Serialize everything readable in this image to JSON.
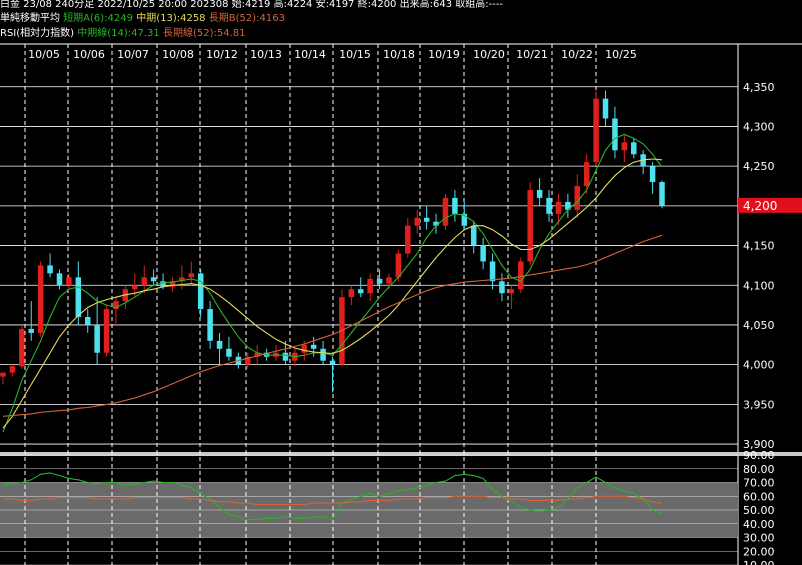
{
  "header": {
    "line1": "白金 23/08 240分足 2022/10/25 20:00 202308 始:4219 高:4224 安:4197 終:4200 出来高:643 取組高:----",
    "ma_title": "単純移動平均",
    "ma_short": "短期A(6):4249",
    "ma_mid": "中期(13):4258",
    "ma_long": "長期B(52):4163",
    "rsi_title": "RSI(相対力指数)",
    "rsi_mid": "中期線(14):47.31",
    "rsi_long": "長期線(52):54.81"
  },
  "colors": {
    "up": "#e0201c",
    "down": "#4fe0f0",
    "ma_short": "#28b428",
    "ma_mid": "#e6dc5a",
    "ma_long": "#d2643c",
    "grid": "#ffffff",
    "price_badge": "#e0101c"
  },
  "chart_data": [
    {
      "type": "candlestick",
      "x_ticks": [
        "10/05",
        "10/06",
        "10/07",
        "10/08",
        "10/12",
        "10/13",
        "10/14",
        "10/15",
        "10/18",
        "10/19",
        "10/20",
        "10/21",
        "10/22",
        "10/25"
      ],
      "y_ticks": [
        "4,350",
        "4,300",
        "4,250",
        "4,200",
        "4,150",
        "4,100",
        "4,050",
        "4,000",
        "3,950",
        "3,900"
      ],
      "ylim": [
        3890,
        4390
      ],
      "last_price_label": "4,200",
      "ohlc": [
        [
          3985,
          3990,
          3975,
          3990
        ],
        [
          3990,
          4000,
          3985,
          3998
        ],
        [
          3998,
          4050,
          3995,
          4045
        ],
        [
          4045,
          4080,
          4030,
          4040
        ],
        [
          4040,
          4130,
          4035,
          4125
        ],
        [
          4125,
          4140,
          4110,
          4115
        ],
        [
          4115,
          4120,
          4095,
          4100
        ],
        [
          4100,
          4115,
          4095,
          4110
        ],
        [
          4110,
          4130,
          4050,
          4060
        ],
        [
          4060,
          4070,
          4040,
          4050
        ],
        [
          4050,
          4085,
          4000,
          4015
        ],
        [
          4015,
          4075,
          4010,
          4070
        ],
        [
          4070,
          4085,
          4050,
          4080
        ],
        [
          4080,
          4100,
          4070,
          4095
        ],
        [
          4095,
          4115,
          4085,
          4100
        ],
        [
          4100,
          4125,
          4090,
          4110
        ],
        [
          4110,
          4120,
          4100,
          4105
        ],
        [
          4105,
          4115,
          4095,
          4098
        ],
        [
          4098,
          4110,
          4092,
          4105
        ],
        [
          4105,
          4125,
          4095,
          4110
        ],
        [
          4110,
          4130,
          4100,
          4115
        ],
        [
          4115,
          4120,
          4060,
          4070
        ],
        [
          4070,
          4080,
          4020,
          4030
        ],
        [
          4030,
          4040,
          4000,
          4020
        ],
        [
          4020,
          4035,
          4005,
          4010
        ],
        [
          4010,
          4015,
          3995,
          4000
        ],
        [
          4000,
          4015,
          3995,
          4010
        ],
        [
          4010,
          4025,
          4000,
          4015
        ],
        [
          4015,
          4020,
          4005,
          4010
        ],
        [
          4010,
          4025,
          4005,
          4015
        ],
        [
          4015,
          4030,
          4000,
          4005
        ],
        [
          4005,
          4020,
          3998,
          4015
        ],
        [
          4015,
          4030,
          4005,
          4025
        ],
        [
          4025,
          4035,
          4010,
          4020
        ],
        [
          4020,
          4030,
          4000,
          4005
        ],
        [
          4005,
          4010,
          3965,
          4000
        ],
        [
          4000,
          4095,
          3998,
          4085
        ],
        [
          4085,
          4100,
          4075,
          4095
        ],
        [
          4095,
          4110,
          4085,
          4090
        ],
        [
          4090,
          4115,
          4080,
          4108
        ],
        [
          4108,
          4120,
          4095,
          4102
        ],
        [
          4102,
          4115,
          4095,
          4110
        ],
        [
          4110,
          4145,
          4105,
          4140
        ],
        [
          4140,
          4185,
          4135,
          4175
        ],
        [
          4175,
          4195,
          4165,
          4185
        ],
        [
          4185,
          4200,
          4170,
          4180
        ],
        [
          4180,
          4190,
          4165,
          4175
        ],
        [
          4175,
          4215,
          4170,
          4210
        ],
        [
          4210,
          4220,
          4180,
          4190
        ],
        [
          4190,
          4205,
          4170,
          4175
        ],
        [
          4175,
          4180,
          4140,
          4150
        ],
        [
          4150,
          4160,
          4120,
          4130
        ],
        [
          4130,
          4140,
          4095,
          4105
        ],
        [
          4105,
          4115,
          4080,
          4090
        ],
        [
          4090,
          4100,
          4070,
          4095
        ],
        [
          4095,
          4135,
          4090,
          4130
        ],
        [
          4130,
          4230,
          4125,
          4220
        ],
        [
          4220,
          4235,
          4200,
          4210
        ],
        [
          4210,
          4220,
          4180,
          4190
        ],
        [
          4190,
          4215,
          4175,
          4205
        ],
        [
          4205,
          4215,
          4185,
          4195
        ],
        [
          4195,
          4240,
          4185,
          4225
        ],
        [
          4225,
          4265,
          4215,
          4255
        ],
        [
          4255,
          4345,
          4250,
          4335
        ],
        [
          4335,
          4345,
          4300,
          4310
        ],
        [
          4310,
          4325,
          4260,
          4270
        ],
        [
          4270,
          4290,
          4255,
          4280
        ],
        [
          4280,
          4285,
          4260,
          4265
        ],
        [
          4265,
          4270,
          4240,
          4250
        ],
        [
          4250,
          4255,
          4215,
          4230
        ],
        [
          4230,
          4232,
          4197,
          4200
        ]
      ],
      "series": [
        {
          "name": "短期A(6)",
          "values": [
            3915,
            3945,
            3980,
            4005,
            4030,
            4060,
            4085,
            4095,
            4098,
            4090,
            4080,
            4075,
            4072,
            4078,
            4085,
            4093,
            4100,
            4103,
            4104,
            4106,
            4108,
            4105,
            4090,
            4070,
            4052,
            4035,
            4022,
            4015,
            4012,
            4012,
            4012,
            4010,
            4012,
            4015,
            4015,
            4012,
            4025,
            4040,
            4055,
            4070,
            4085,
            4098,
            4110,
            4125,
            4140,
            4160,
            4175,
            4185,
            4190,
            4188,
            4180,
            4165,
            4145,
            4125,
            4110,
            4105,
            4120,
            4145,
            4165,
            4180,
            4195,
            4205,
            4220,
            4245,
            4270,
            4285,
            4290,
            4285,
            4278,
            4265,
            4249
          ]
        },
        {
          "name": "中期(13)",
          "values": [
            3920,
            3935,
            3955,
            3975,
            3995,
            4015,
            4035,
            4050,
            4062,
            4072,
            4078,
            4082,
            4085,
            4088,
            4090,
            4093,
            4095,
            4098,
            4100,
            4101,
            4102,
            4100,
            4095,
            4087,
            4078,
            4068,
            4058,
            4048,
            4040,
            4032,
            4026,
            4021,
            4018,
            4016,
            4015,
            4014,
            4018,
            4025,
            4033,
            4042,
            4052,
            4062,
            4075,
            4090,
            4105,
            4120,
            4135,
            4148,
            4160,
            4170,
            4175,
            4175,
            4170,
            4162,
            4152,
            4145,
            4145,
            4150,
            4158,
            4168,
            4178,
            4188,
            4198,
            4210,
            4225,
            4238,
            4248,
            4255,
            4258,
            4259,
            4258
          ]
        },
        {
          "name": "長期B(52)",
          "values": [
            3935,
            3936,
            3937,
            3938,
            3940,
            3941,
            3942,
            3943,
            3945,
            3946,
            3948,
            3950,
            3952,
            3955,
            3958,
            3962,
            3966,
            3971,
            3976,
            3981,
            3986,
            3991,
            3995,
            3999,
            4002,
            4005,
            4008,
            4011,
            4014,
            4017,
            4020,
            4023,
            4026,
            4030,
            4034,
            4038,
            4043,
            4049,
            4055,
            4061,
            4067,
            4073,
            4078,
            4083,
            4088,
            4093,
            4097,
            4100,
            4102,
            4104,
            4105,
            4106,
            4107,
            4108,
            4109,
            4111,
            4113,
            4115,
            4117,
            4119,
            4121,
            4123,
            4126,
            4130,
            4135,
            4140,
            4145,
            4150,
            4155,
            4159,
            4163
          ]
        }
      ]
    },
    {
      "type": "line",
      "title": "RSI(相対力指数)",
      "y_ticks": [
        "90.00",
        "80.00",
        "70.00",
        "60.00",
        "50.00",
        "40.00",
        "30.00",
        "20.00",
        "10.00"
      ],
      "ylim": [
        10,
        90
      ],
      "band": [
        30,
        70
      ],
      "series": [
        {
          "name": "中期線(14)",
          "values": [
            68,
            69,
            70,
            72,
            76,
            77,
            75,
            73,
            72,
            70,
            69,
            70,
            70,
            68,
            69,
            70,
            71,
            70,
            70,
            68,
            66,
            62,
            58,
            52,
            47,
            45,
            43,
            43,
            44,
            44,
            45,
            44,
            44,
            45,
            45,
            43,
            55,
            58,
            60,
            62,
            60,
            62,
            64,
            65,
            66,
            68,
            70,
            71,
            75,
            76,
            75,
            73,
            65,
            60,
            56,
            52,
            50,
            49,
            50,
            52,
            58,
            66,
            70,
            74,
            70,
            66,
            64,
            62,
            58,
            50,
            47.31
          ]
        },
        {
          "name": "長期線(52)",
          "values": [
            58,
            58,
            57,
            57,
            58,
            58,
            59,
            59,
            59,
            59,
            58,
            58,
            58,
            58,
            59,
            59,
            59,
            59,
            59,
            59,
            58,
            58,
            57,
            56,
            56,
            55,
            55,
            54,
            54,
            54,
            54,
            54,
            54,
            55,
            55,
            55,
            55,
            56,
            56,
            57,
            57,
            57,
            58,
            58,
            58,
            59,
            59,
            59,
            60,
            60,
            60,
            60,
            59,
            59,
            58,
            58,
            57,
            57,
            57,
            57,
            58,
            58,
            59,
            60,
            60,
            60,
            60,
            59,
            58,
            56,
            54.81
          ]
        }
      ]
    }
  ]
}
